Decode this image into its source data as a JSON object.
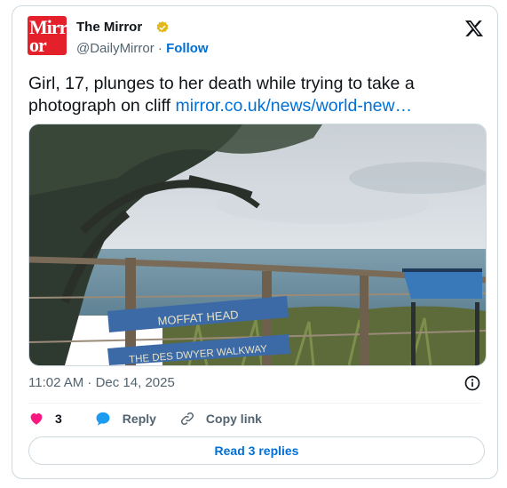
{
  "account": {
    "avatar_text_line1": "Mirr",
    "avatar_text_line2": "or",
    "name": "The Mirror",
    "handle": "@DailyMirror",
    "separator": "·",
    "follow_label": "Follow"
  },
  "tweet": {
    "text": "Girl, 17, plunges to her death while trying to take a photograph on cliff ",
    "link_text": "mirror.co.uk/news/world-new…",
    "timestamp": "11:02 AM · Dec 14, 2025"
  },
  "photo": {
    "sign_top": "MOFFAT HEAD",
    "sign_bottom": "THE DES DWYER WALKWAY"
  },
  "actions": {
    "like_count": "3",
    "reply_label": "Reply",
    "copy_label": "Copy link"
  },
  "read_replies_label": "Read 3 replies",
  "colors": {
    "brand_red": "#e4212b",
    "link_blue": "#006fd6",
    "like_pink": "#f91880",
    "verified_gold": "#e2b719"
  }
}
